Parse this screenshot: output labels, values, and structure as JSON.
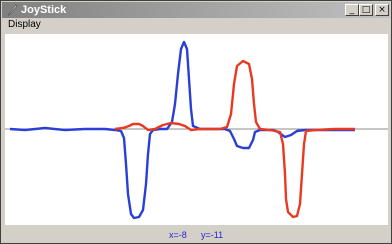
{
  "window": {
    "title": "JoyStick",
    "icon": "feather-pen-icon",
    "buttons": {
      "minimize": "_",
      "maximize": "□",
      "close": "×"
    }
  },
  "menu": [
    {
      "label": "Display"
    }
  ],
  "plot": {
    "baseline_color": "#8c8c8c",
    "series": [
      {
        "color": "#2a3fd6",
        "points": [
          [
            5,
            95
          ],
          [
            20,
            96
          ],
          [
            40,
            94
          ],
          [
            60,
            96
          ],
          [
            80,
            95
          ],
          [
            100,
            95
          ],
          [
            110,
            96
          ],
          [
            116,
            97
          ],
          [
            119,
            104
          ],
          [
            121,
            130
          ],
          [
            123,
            160
          ],
          [
            126,
            180
          ],
          [
            129,
            184
          ],
          [
            134,
            183
          ],
          [
            138,
            176
          ],
          [
            141,
            150
          ],
          [
            143,
            120
          ],
          [
            145,
            100
          ],
          [
            148,
            96
          ],
          [
            155,
            95
          ],
          [
            162,
            95
          ],
          [
            167,
            88
          ],
          [
            170,
            70
          ],
          [
            173,
            40
          ],
          [
            176,
            15
          ],
          [
            179,
            8
          ],
          [
            182,
            15
          ],
          [
            184,
            45
          ],
          [
            186,
            75
          ],
          [
            188,
            92
          ],
          [
            195,
            95
          ],
          [
            210,
            95
          ],
          [
            220,
            95
          ],
          [
            225,
            97
          ],
          [
            229,
            105
          ],
          [
            232,
            112
          ],
          [
            238,
            114
          ],
          [
            244,
            114
          ],
          [
            248,
            106
          ],
          [
            250,
            98
          ],
          [
            255,
            96
          ],
          [
            262,
            96
          ],
          [
            268,
            96
          ],
          [
            273,
            98
          ],
          [
            280,
            103
          ],
          [
            286,
            101
          ],
          [
            292,
            97
          ],
          [
            300,
            96
          ],
          [
            320,
            96
          ],
          [
            350,
            96
          ]
        ]
      },
      {
        "color": "#e83a22",
        "points": [
          [
            110,
            95
          ],
          [
            118,
            94
          ],
          [
            124,
            92
          ],
          [
            128,
            90
          ],
          [
            134,
            90
          ],
          [
            138,
            92
          ],
          [
            143,
            96
          ],
          [
            150,
            95
          ],
          [
            158,
            91
          ],
          [
            166,
            89
          ],
          [
            174,
            90
          ],
          [
            180,
            92
          ],
          [
            186,
            96
          ],
          [
            195,
            95
          ],
          [
            215,
            95
          ],
          [
            222,
            93
          ],
          [
            226,
            80
          ],
          [
            229,
            50
          ],
          [
            232,
            32
          ],
          [
            238,
            27
          ],
          [
            244,
            30
          ],
          [
            247,
            45
          ],
          [
            249,
            70
          ],
          [
            251,
            88
          ],
          [
            255,
            95
          ],
          [
            265,
            96
          ],
          [
            275,
            98
          ],
          [
            278,
            110
          ],
          [
            280,
            140
          ],
          [
            281,
            165
          ],
          [
            283,
            178
          ],
          [
            288,
            183
          ],
          [
            292,
            182
          ],
          [
            295,
            170
          ],
          [
            297,
            140
          ],
          [
            299,
            110
          ],
          [
            301,
            97
          ],
          [
            310,
            96
          ],
          [
            330,
            95
          ],
          [
            350,
            95
          ]
        ]
      }
    ]
  },
  "status": {
    "x_label": "x=-8",
    "y_label": "y=-11"
  }
}
